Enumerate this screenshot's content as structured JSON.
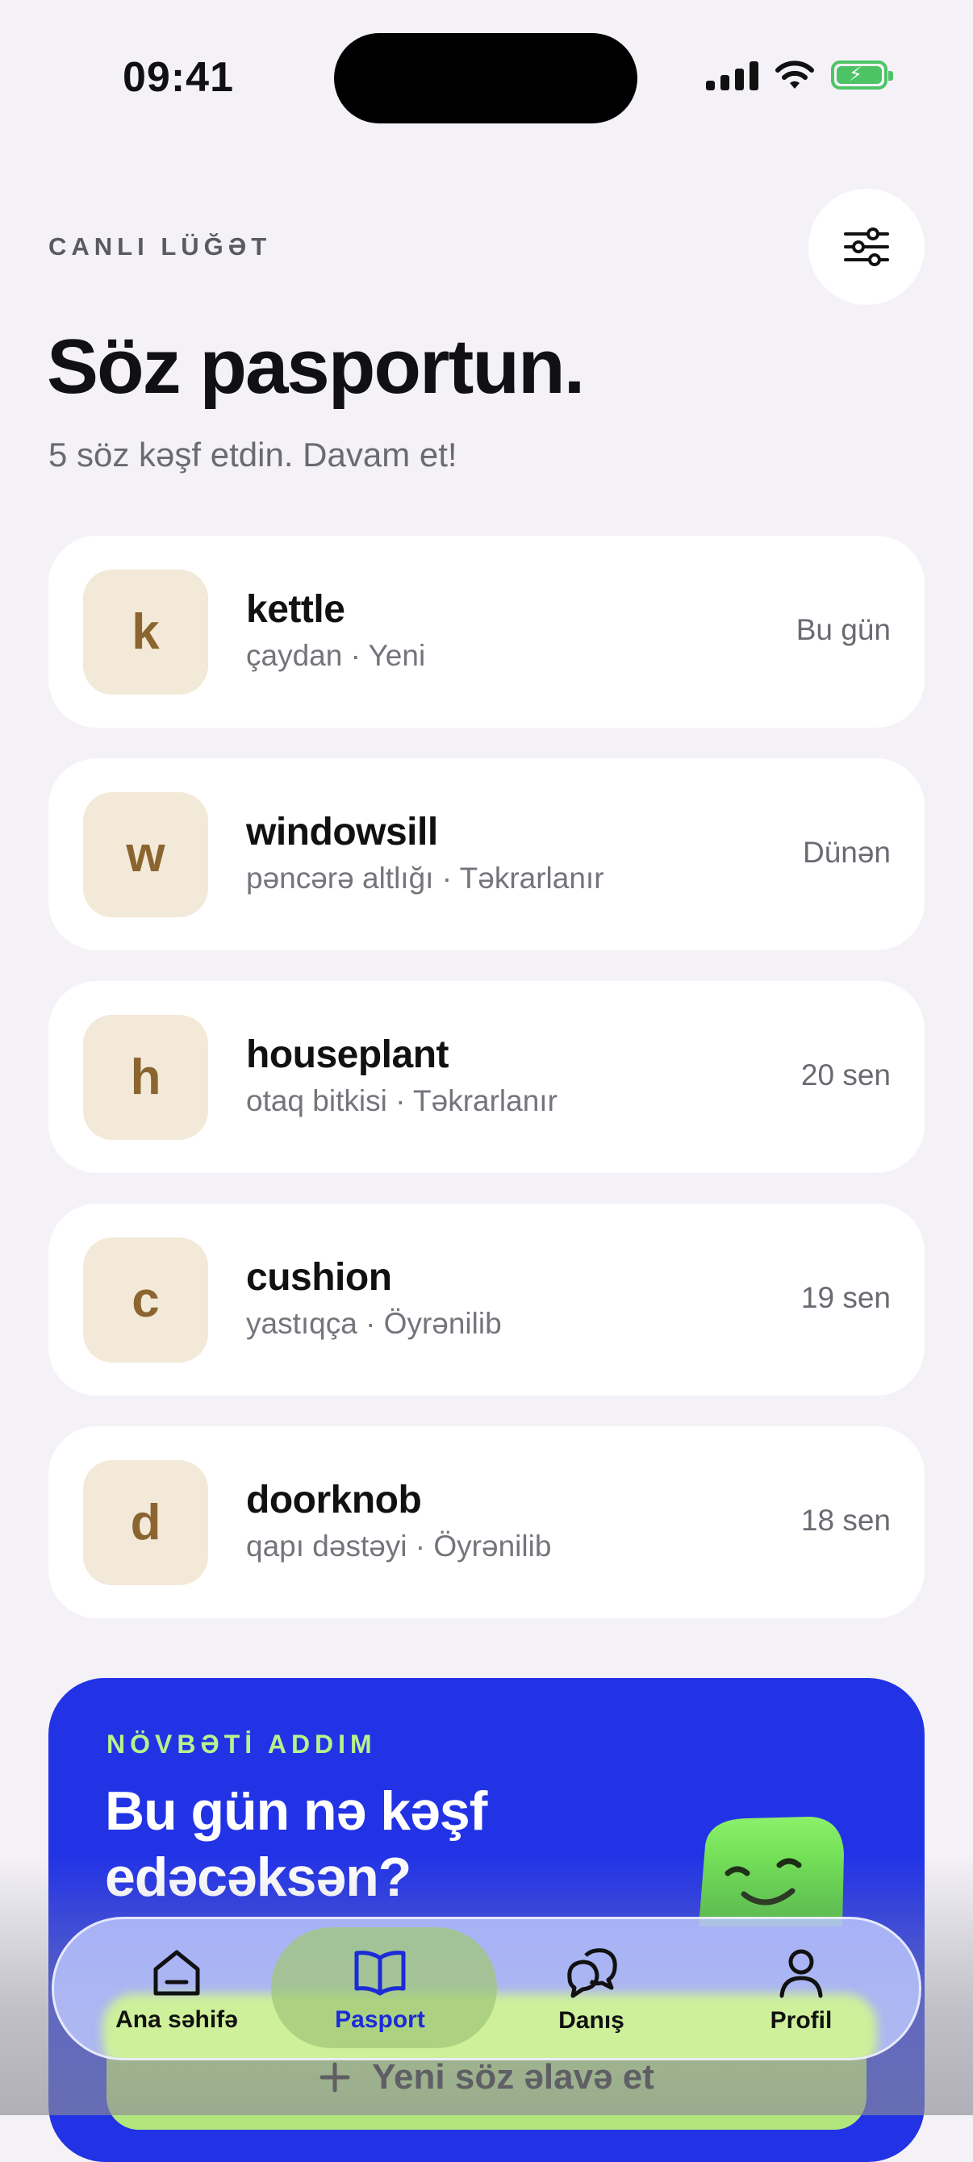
{
  "status_bar": {
    "time": "09:41"
  },
  "header": {
    "overline": "CANLI LÜĞƏT",
    "title": "Söz pasportun.",
    "subtitle": "5 söz kəşf etdin. Davam et!"
  },
  "words": [
    {
      "letter": "k",
      "word": "kettle",
      "meta": "çaydan · Yeni",
      "date": "Bu gün"
    },
    {
      "letter": "w",
      "word": "windowsill",
      "meta": "pəncərə altlığı · Təkrarlanır",
      "date": "Dünən"
    },
    {
      "letter": "h",
      "word": "houseplant",
      "meta": "otaq bitkisi · Təkrarlanır",
      "date": "20 sen"
    },
    {
      "letter": "c",
      "word": "cushion",
      "meta": "yastıqça · Öyrənilib",
      "date": "19 sen"
    },
    {
      "letter": "d",
      "word": "doorknob",
      "meta": "qapı dəstəyi · Öyrənilib",
      "date": "18 sen"
    }
  ],
  "cta": {
    "overline": "NÖVBƏTİ ADDIM",
    "title": "Bu gün nə kəşf edəcəksən?",
    "button_label": "Yeni söz əlavə et",
    "button_icon": "plus-icon"
  },
  "tabs": [
    {
      "label": "Ana səhifə",
      "icon": "home-icon",
      "active": false
    },
    {
      "label": "Pasport",
      "icon": "book-icon",
      "active": true
    },
    {
      "label": "Danış",
      "icon": "chat-icon",
      "active": false
    },
    {
      "label": "Profil",
      "icon": "profile-icon",
      "active": false
    }
  ],
  "colors": {
    "background": "#F4F2F7",
    "accent_blue": "#2233E6",
    "accent_green": "#B3E57D",
    "tile_beige": "#F3E9D8",
    "tile_letter": "#8B6530",
    "battery_green": "#4CC466"
  }
}
